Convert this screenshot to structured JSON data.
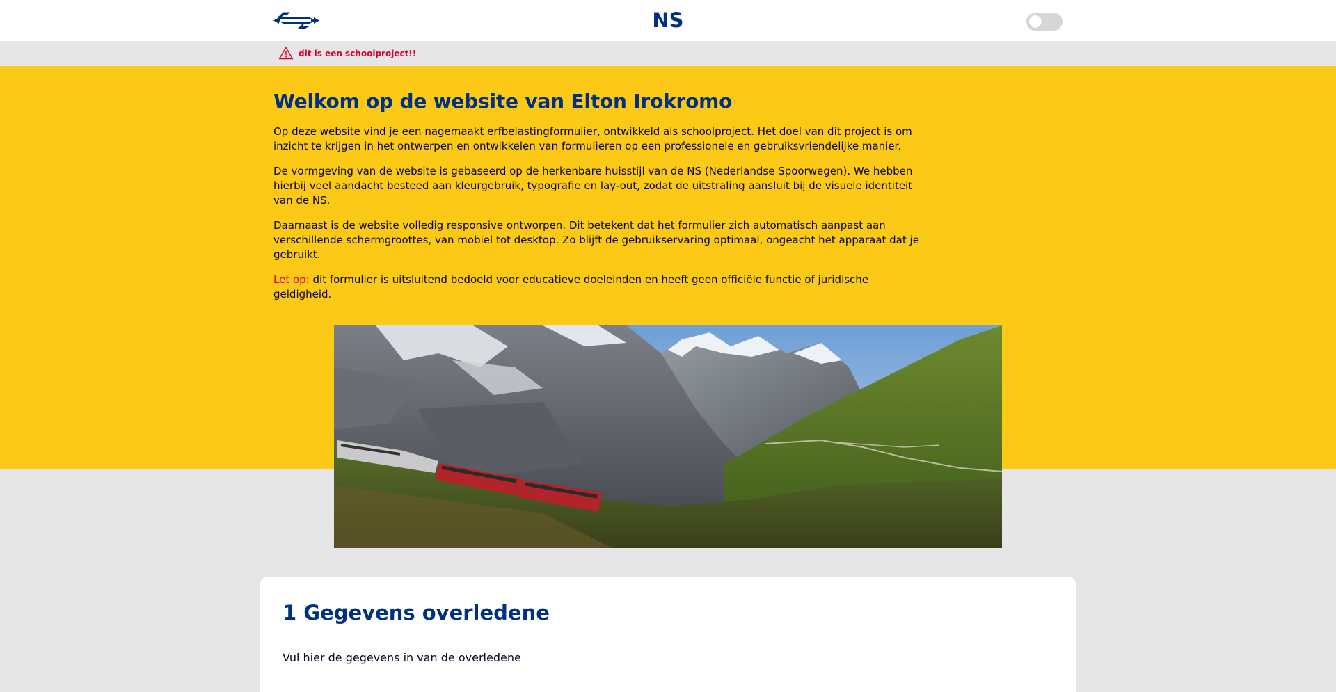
{
  "header": {
    "logo_icon": "ns-logo-icon",
    "title": "NS",
    "toggle_icon": "theme-toggle",
    "brand_color": "#003082"
  },
  "warning": {
    "icon": "warning-triangle-icon",
    "text": "dit is een schoolproject!!",
    "color": "#db0029"
  },
  "hero": {
    "background": "#fcc917",
    "title": "Welkom op de website van Elton Irokromo",
    "paragraphs": [
      "Op deze website vind je een nagemaakt erfbelastingformulier, ontwikkeld als schoolproject. Het doel van dit project is om inzicht te krijgen in het ontwerpen en ontwikkelen van formulieren op een professionele en gebruiksvriendelijke manier.",
      "De vormgeving van de website is gebaseerd op de herkenbare huisstijl van de NS (Nederlandse Spoorwegen). We hebben hierbij veel aandacht besteed aan kleurgebruik, typografie en lay-out, zodat de uitstraling aansluit bij de visuele identiteit van de NS.",
      "Daarnaast is de website volledig responsive ontworpen. Dit betekent dat het formulier zich automatisch aanpast aan verschillende schermgroottes, van mobiel tot desktop. Zo blijft de gebruikservaring optimaal, ongeacht het apparaat dat je gebruikt."
    ],
    "note_label": "Let op:",
    "note_text": " dit formulier is uitsluitend bedoeld voor educatieve doeleinden en heeft geen officiële functie of juridische geldigheid."
  },
  "photo": {
    "subject": "mountain-train-photo"
  },
  "form": {
    "section_title": "1 Gegevens overledene",
    "section_intro": "Vul hier de gegevens in van de overledene"
  }
}
